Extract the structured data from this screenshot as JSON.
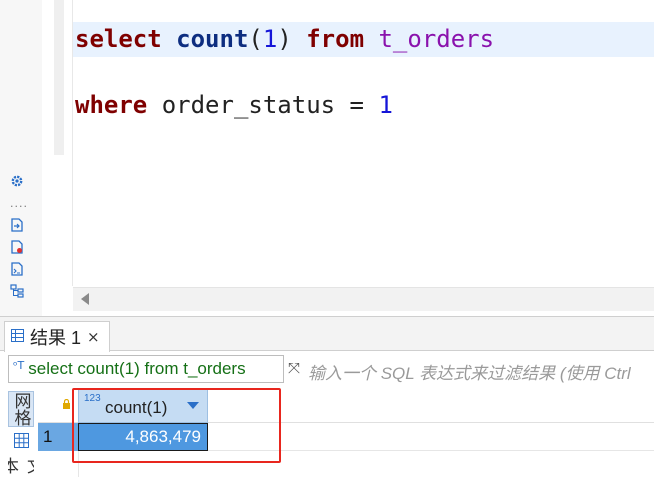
{
  "editor": {
    "line1": {
      "kw_select": "select",
      "fn_count": "count",
      "p_open": "(",
      "num_one": "1",
      "p_close": ")",
      "kw_from": "from",
      "table": "t_orders"
    },
    "line2": {
      "kw_where": "where",
      "column": "order_status",
      "op": "=",
      "value": "1"
    },
    "side_icons": [
      "settings-icon",
      "export-icon",
      "file-error-icon",
      "script-icon",
      "outline-icon"
    ],
    "gutter_dots": "....",
    "colors": {
      "keyword": "#7f0000",
      "function": "#0d2d80",
      "number": "#1515d8",
      "table": "#8a12ad",
      "current_line": "#e8f2fe"
    }
  },
  "results": {
    "tab": {
      "label": "结果 1",
      "close": "×"
    },
    "filter": {
      "sql_icon": "ᵒT",
      "sql_text": "select count(1) from t_orders",
      "expand_icon": "⤧",
      "placeholder": "输入一个 SQL 表达式来过滤结果 (使用 Ctrl"
    },
    "side_tabs": {
      "grid": "网格",
      "text": "文本"
    },
    "grid": {
      "column_type_badge": "123",
      "columns": [
        "count(1)"
      ],
      "rows": [
        {
          "num": "1",
          "values": [
            "4,863,479"
          ]
        }
      ]
    },
    "highlight_color": "#e8261e"
  }
}
